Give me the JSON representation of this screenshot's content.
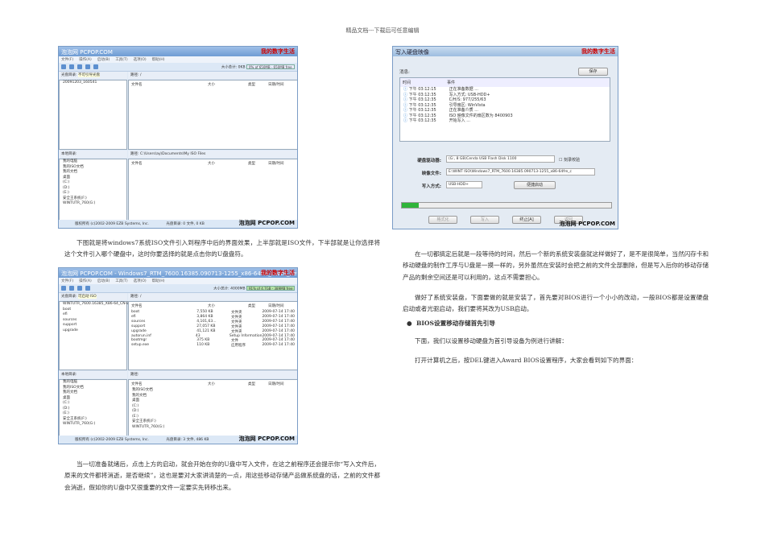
{
  "header": "精品文档---下载后可任意编辑",
  "shot1": {
    "title": "泡泡网 PCPOP.COM",
    "brand": "我的数字生活",
    "menu": [
      "文件(F)",
      "操作(A)",
      "启动(B)",
      "工具(T)",
      "选项(O)",
      "帮助(H)"
    ],
    "size_label": "大小总计:",
    "size_value": "0KB",
    "capacity": "0% of 650MB - 650MB free",
    "disc_label": "光盘目录:",
    "disc_value": "不可引导光盘",
    "path_top": "路径: /",
    "tree_top": [
      "20091203_160541"
    ],
    "cols": [
      "文件名",
      "大小",
      "类型",
      "日期/时间"
    ],
    "local_label": "本地目录:",
    "path_bottom": "路径: C:\\Users\\ay\\Documents\\My ISO Files",
    "tree_bottom": [
      "我的电脑",
      "我的ISO文档",
      "我的文档",
      "桌面",
      "(C:)",
      "(D:)",
      "(E:)",
      "安全王系统(F:)",
      "WINTUTR_760(G:)"
    ],
    "status_left": "版权所有 (c)2002-2009 EZB Systems, Inc.",
    "status_right": "光盘目录: 0 文件, 0 KB",
    "watermark": "泡泡网 PCPOP.COM"
  },
  "para1": "下图就是将windows7系统ISO文件引入到程序中后的界面效果，上半部就是ISO文件，下半部就是让你选择将这个文件引入哪个硬盘中，这时你要选择的就是点击你的U盘盘符。",
  "shot2": {
    "title": "泡泡网 PCPOP.COM - Windows7_RTM_7600.16385.090713-1255_x86-64fre_client_Retail_16in1_CN-E",
    "brand": "我的数字生活",
    "size_value": "4000MB",
    "capacity": "91% of 4.7GB - 389MB free",
    "disc_value": "可启动 ISO",
    "path_top": "路径: /",
    "tree_top": [
      "WINTUTR_7600.16385_X86-64_CN-EN",
      "boot",
      "efi",
      "sources",
      "support",
      "upgrade"
    ],
    "files": [
      [
        "boot",
        "7,550 KB",
        "文件夹",
        "2009-07-14 17:40"
      ],
      [
        "efi",
        "3,864 KB",
        "文件夹",
        "2009-07-14 17:40"
      ],
      [
        "sources",
        "4,101,63...",
        "文件夹",
        "2009-07-14 17:40"
      ],
      [
        "support",
        "27,057 KB",
        "文件夹",
        "2009-07-14 17:40"
      ],
      [
        "upgrade",
        "41,121 KB",
        "文件夹",
        "2009-07-14 17:40"
      ],
      [
        "autorun.inf",
        "43",
        "Setup Information",
        "2009-07-14 17:40"
      ],
      [
        "bootmgr",
        "375 KB",
        "文件",
        "2009-07-14 17:40"
      ],
      [
        "setup.exe",
        "110 KB",
        "应用程序",
        "2009-07-14 17:40"
      ]
    ],
    "path_bottom": "路径:",
    "bottom_files": [
      "我的ISO文档",
      "我的文档",
      "桌面",
      "(C:)",
      "(D:)",
      "(E:)",
      "安全王系统(F:)",
      "WINTUTR_760(G:)"
    ],
    "status_right": "光盘目录: 3 文件, 486 KB"
  },
  "para2": "当一切准备就绪后，点击上方的启动，就会开始在你的U盘中写入文件，在这之前程序还会提示你“写入文件后，原来的文件都将消逝，是否继续”，这也是要对大家讲清楚的一点，用这些移动存储产品做系统盘的话，之前的文件都会消逝，假如你的U盘中又很重要的文件一定要实先转移出来。",
  "shot3": {
    "title": "写入硬盘映像",
    "brand": "我的数字生活",
    "msg_label": "消息:",
    "save": "保存",
    "cols": [
      "时间",
      "事件"
    ],
    "log": [
      [
        "下午 03:12:15",
        "正在准备数据 ..."
      ],
      [
        "下午 03:12:35",
        "写入方式: USB-HDD+"
      ],
      [
        "下午 03:12:35",
        "C/H/S: 977/255/63"
      ],
      [
        "下午 03:12:35",
        "引导扇区: WinVista"
      ],
      [
        "下午 03:12:35",
        "正在准备介质 ..."
      ],
      [
        "下午 03:12:35",
        "ISO 映像文件的扇区数为 8400903"
      ],
      [
        "下午 03:12:35",
        "开始写入 ..."
      ]
    ],
    "drive_label": "硬盘驱动器:",
    "drive_value": "(G:, 8 GB)Cenda   USB Flash Disk  1100",
    "verify": "刻录校验",
    "image_label": "映像文件:",
    "image_value": "E:\\WINT ISO\\Windows7_RTM_7600.16385.090713-1255_x86-64fre_c",
    "mode_label": "写入方式:",
    "mode_value": "USB-HDD+",
    "boot_btn": "便捷启动",
    "progress": 0.08,
    "buttons": [
      "格式化",
      "写入",
      "终止[A]",
      "返回"
    ],
    "watermark": "泡泡网 PCPOP.COM"
  },
  "para3": "在一切都搞定后就是一段等待的时间，然后一个新的系统安装盘就这样做好了，是不是很简单，当然闪存卡和移动硬盘的制作工序与U盘是一摸一样的，另外虽然在安装时会把之前的文件全部删除，但是写入后你的移动存储产品的剩余空间还是可以利用的，这点不需要担心。",
  "para4": "做好了系统安装盘，下面要做的就是安装了，首先要对BIOS进行一个小小的改动，一般BIOS都是设置硬盘启动或者光驱启动，我们要将其改为USB启动。",
  "bullet": "BIOS设置移动存储首先引导",
  "para5": "下面，我们以设置移动硬盘为首引导设备为例进行讲解：",
  "para6": "打开计算机之后，按DEL键进入Award BIOS设置程序，大家会看到如下的界面："
}
